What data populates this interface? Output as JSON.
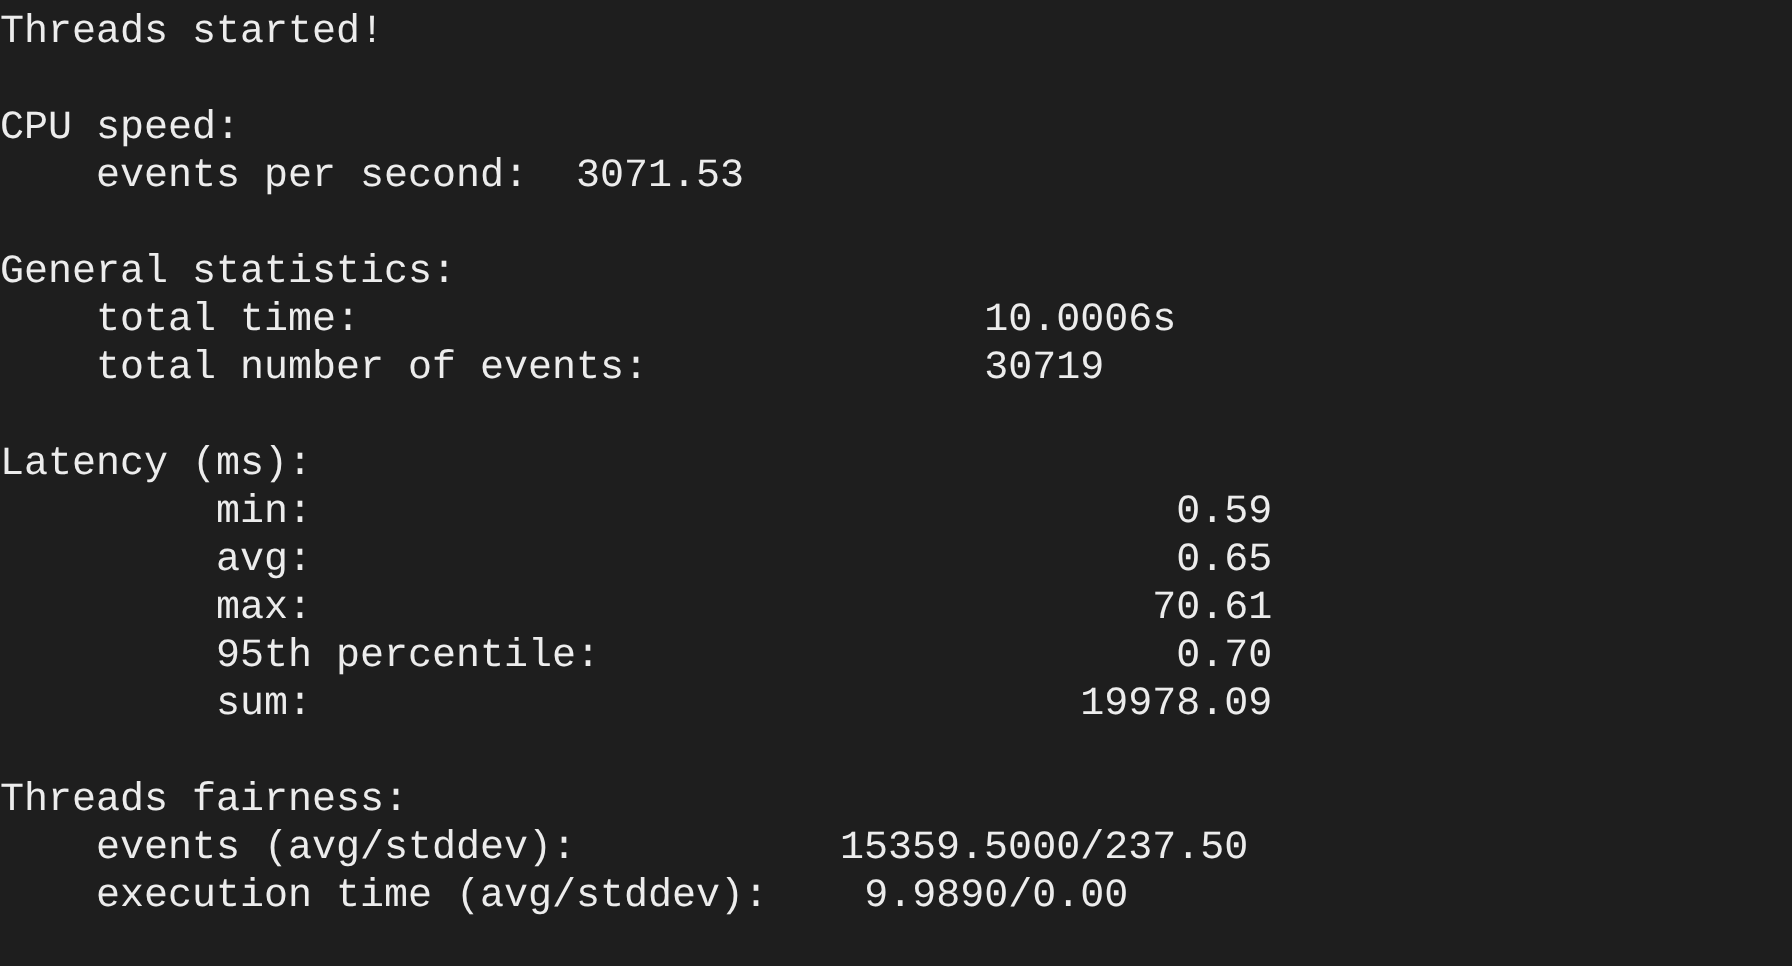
{
  "terminal": {
    "sections": [
      {
        "title": "Threads started!"
      },
      {
        "title": "CPU speed:",
        "rows": [
          {
            "label": "events per second:",
            "value": "3071.53"
          }
        ]
      },
      {
        "title": "General statistics:",
        "rows": [
          {
            "label": "total time:",
            "value": "10.0006s"
          },
          {
            "label": "total number of events:",
            "value": "30719"
          }
        ]
      },
      {
        "title": "Latency (ms):",
        "rows": [
          {
            "label": "min:",
            "value": "0.59"
          },
          {
            "label": "avg:",
            "value": "0.65"
          },
          {
            "label": "max:",
            "value": "70.61"
          },
          {
            "label": "95th percentile:",
            "value": "0.70"
          },
          {
            "label": "sum:",
            "value": "19978.09"
          }
        ]
      },
      {
        "title": "Threads fairness:",
        "rows": [
          {
            "label": "events (avg/stddev):",
            "value": "15359.5000/237.50"
          },
          {
            "label": "execution time (avg/stddev):",
            "value": "9.9890/0.00"
          }
        ]
      }
    ]
  }
}
